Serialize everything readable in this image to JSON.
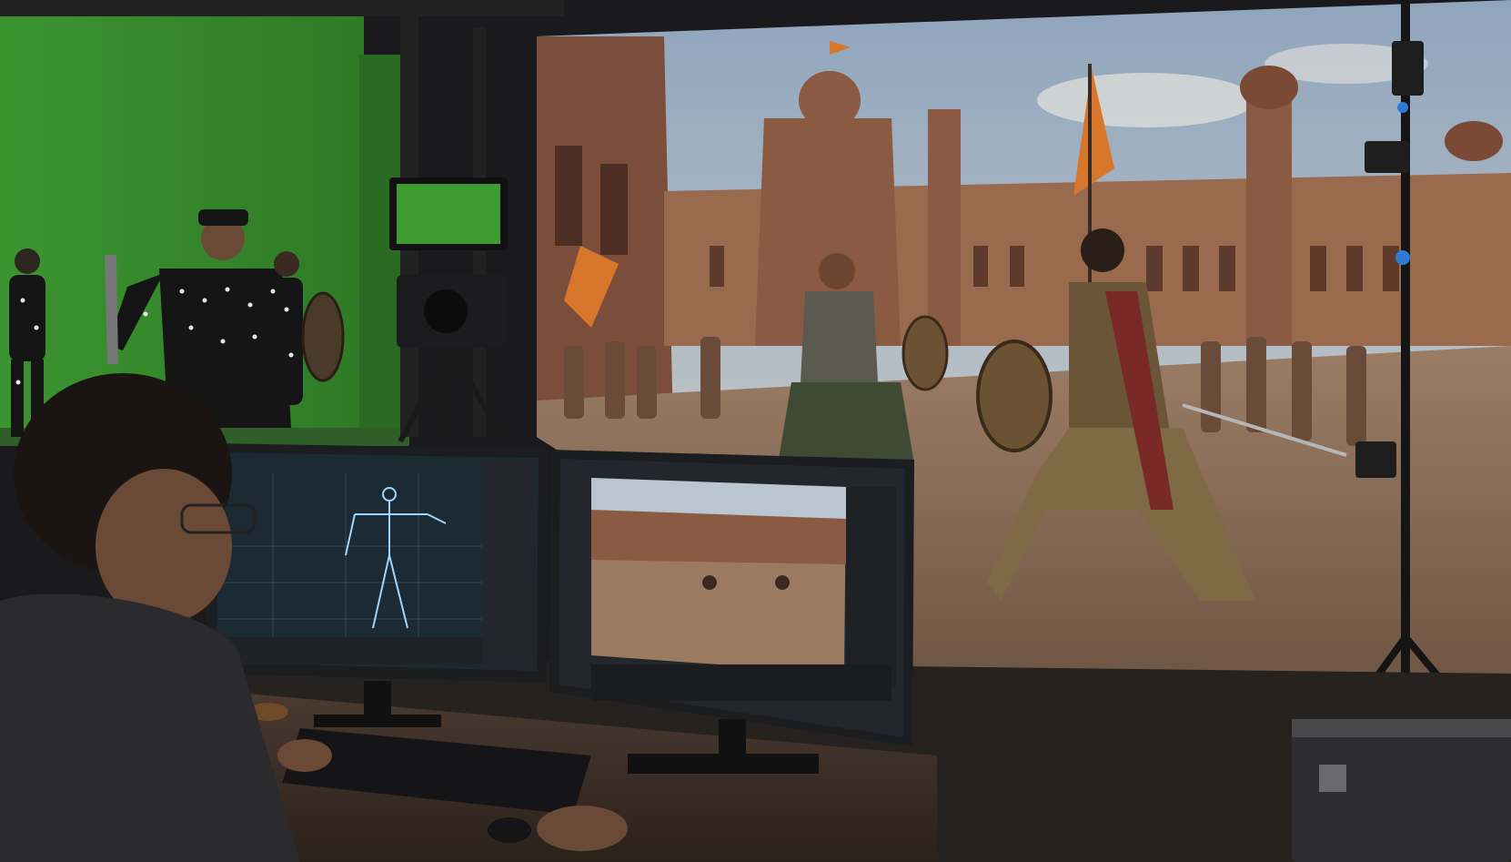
{
  "scene": {
    "description_id": "mocap-virtual-production-studio",
    "colors": {
      "green_screen": "#3f9a32",
      "green_screen_shadow": "#2c6e24",
      "sky": "#b8c6d4",
      "palace": "#9a6a4e",
      "palace_dark": "#6e4634",
      "ground": "#8a6e58",
      "flag": "#d8772c",
      "monitor_bezel": "#1b1d21",
      "ui_panel": "#23272d",
      "ui_viewport": "#1b2a33",
      "skeleton": "#9fd6ff",
      "desk": "#3a2a22",
      "floor": "#2a2624",
      "road_case": "#2d2d30"
    },
    "icons": [
      "camera-rig-icon",
      "tripod-icon",
      "tracking-camera-icon",
      "keyboard-icon",
      "mouse-icon"
    ]
  }
}
